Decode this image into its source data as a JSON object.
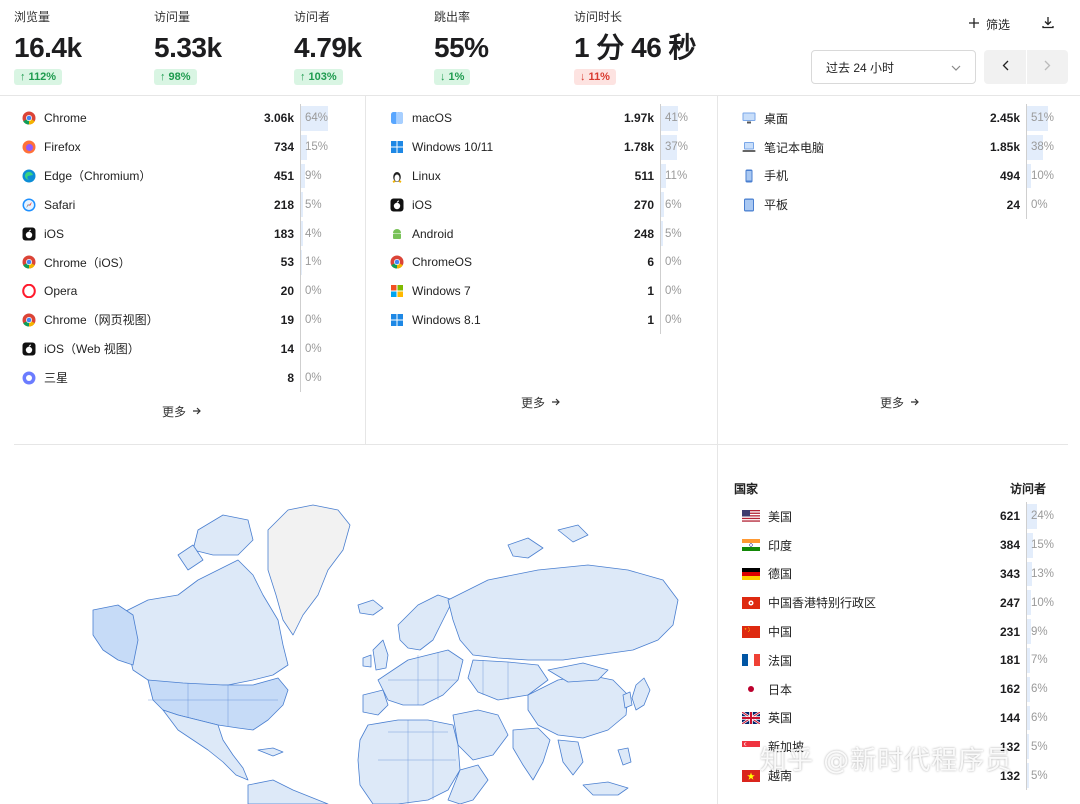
{
  "stats": [
    {
      "label": "浏览量",
      "value": "16.4k",
      "change": "↑ 112%",
      "dir": "up"
    },
    {
      "label": "访问量",
      "value": "5.33k",
      "change": "↑ 98%",
      "dir": "up"
    },
    {
      "label": "访问者",
      "value": "4.79k",
      "change": "↑ 103%",
      "dir": "up"
    },
    {
      "label": "跳出率",
      "value": "55%",
      "change": "↓ 1%",
      "dir": "down-good"
    },
    {
      "label": "访问时长",
      "value": "1 分 46 秒",
      "change": "↓ 11%",
      "dir": "down"
    }
  ],
  "toolbar": {
    "filter_label": "筛选",
    "range_label": "过去 24 小时"
  },
  "browsers": {
    "more_label": "更多",
    "rows": [
      {
        "name": "Chrome",
        "count": "3.06k",
        "pct": "64%",
        "share": 0.64,
        "icon": "chrome-icon"
      },
      {
        "name": "Firefox",
        "count": "734",
        "pct": "15%",
        "share": 0.15,
        "icon": "firefox-icon"
      },
      {
        "name": "Edge（Chromium）",
        "count": "451",
        "pct": "9%",
        "share": 0.09,
        "icon": "edge-icon"
      },
      {
        "name": "Safari",
        "count": "218",
        "pct": "5%",
        "share": 0.05,
        "icon": "safari-icon"
      },
      {
        "name": "iOS",
        "count": "183",
        "pct": "4%",
        "share": 0.04,
        "icon": "apple-icon"
      },
      {
        "name": "Chrome（iOS）",
        "count": "53",
        "pct": "1%",
        "share": 0.01,
        "icon": "chrome-icon"
      },
      {
        "name": "Opera",
        "count": "20",
        "pct": "0%",
        "share": 0,
        "icon": "opera-icon"
      },
      {
        "name": "Chrome（网页视图）",
        "count": "19",
        "pct": "0%",
        "share": 0,
        "icon": "chrome-icon"
      },
      {
        "name": "iOS（Web 视图）",
        "count": "14",
        "pct": "0%",
        "share": 0,
        "icon": "apple-icon"
      },
      {
        "name": "三星",
        "count": "8",
        "pct": "0%",
        "share": 0,
        "icon": "samsung-icon"
      }
    ]
  },
  "os": {
    "more_label": "更多",
    "rows": [
      {
        "name": "macOS",
        "count": "1.97k",
        "pct": "41%",
        "share": 0.41,
        "icon": "macos-icon"
      },
      {
        "name": "Windows 10/11",
        "count": "1.78k",
        "pct": "37%",
        "share": 0.37,
        "icon": "windows-icon"
      },
      {
        "name": "Linux",
        "count": "511",
        "pct": "11%",
        "share": 0.11,
        "icon": "linux-icon"
      },
      {
        "name": "iOS",
        "count": "270",
        "pct": "6%",
        "share": 0.06,
        "icon": "apple-icon"
      },
      {
        "name": "Android",
        "count": "248",
        "pct": "5%",
        "share": 0.05,
        "icon": "android-icon"
      },
      {
        "name": "ChromeOS",
        "count": "6",
        "pct": "0%",
        "share": 0,
        "icon": "chrome-icon"
      },
      {
        "name": "Windows 7",
        "count": "1",
        "pct": "0%",
        "share": 0,
        "icon": "windows7-icon"
      },
      {
        "name": "Windows 8.1",
        "count": "1",
        "pct": "0%",
        "share": 0,
        "icon": "windows-icon"
      }
    ]
  },
  "devices": {
    "more_label": "更多",
    "rows": [
      {
        "name": "桌面",
        "count": "2.45k",
        "pct": "51%",
        "share": 0.51,
        "icon": "desktop-icon"
      },
      {
        "name": "笔记本电脑",
        "count": "1.85k",
        "pct": "38%",
        "share": 0.38,
        "icon": "laptop-icon"
      },
      {
        "name": "手机",
        "count": "494",
        "pct": "10%",
        "share": 0.1,
        "icon": "phone-icon"
      },
      {
        "name": "平板",
        "count": "24",
        "pct": "0%",
        "share": 0,
        "icon": "tablet-icon"
      }
    ]
  },
  "countries": {
    "header_country": "国家",
    "header_visitors": "访问者",
    "rows": [
      {
        "name": "美国",
        "count": "621",
        "pct": "24%",
        "share": 0.24,
        "flag": "us"
      },
      {
        "name": "印度",
        "count": "384",
        "pct": "15%",
        "share": 0.15,
        "flag": "in"
      },
      {
        "name": "德国",
        "count": "343",
        "pct": "13%",
        "share": 0.13,
        "flag": "de"
      },
      {
        "name": "中国香港特别行政区",
        "count": "247",
        "pct": "10%",
        "share": 0.1,
        "flag": "hk"
      },
      {
        "name": "中国",
        "count": "231",
        "pct": "9%",
        "share": 0.09,
        "flag": "cn"
      },
      {
        "name": "法国",
        "count": "181",
        "pct": "7%",
        "share": 0.07,
        "flag": "fr"
      },
      {
        "name": "日本",
        "count": "162",
        "pct": "6%",
        "share": 0.06,
        "flag": "jp"
      },
      {
        "name": "英国",
        "count": "144",
        "pct": "6%",
        "share": 0.06,
        "flag": "gb"
      },
      {
        "name": "新加坡",
        "count": "132",
        "pct": "5%",
        "share": 0.05,
        "flag": "sg"
      },
      {
        "name": "越南",
        "count": "132",
        "pct": "5%",
        "share": 0.05,
        "flag": "vn"
      }
    ]
  },
  "colors": {
    "accent_bar": "#e3edfb",
    "up": "#1f9b4f",
    "down": "#d93b30",
    "map_land": "#dde9f8",
    "map_border": "#4a7fd0"
  },
  "watermark": "知乎 @新时代程序员"
}
